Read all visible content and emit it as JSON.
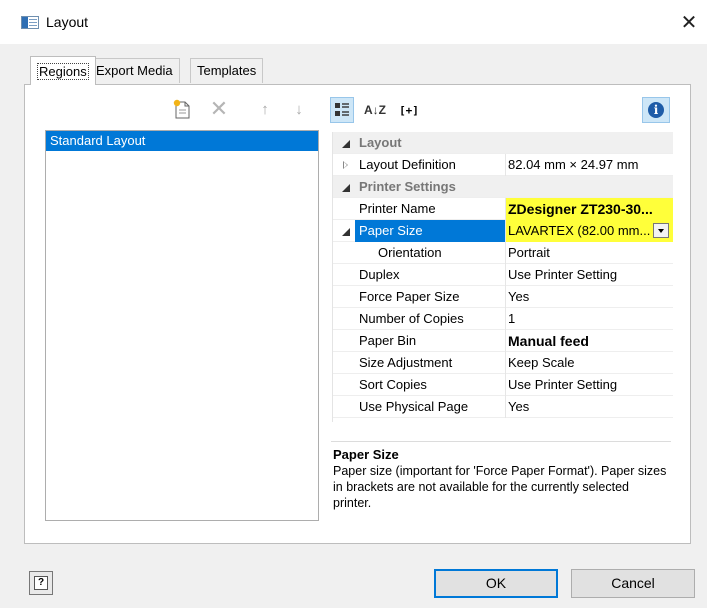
{
  "window": {
    "title": "Layout",
    "close_glyph": "✕"
  },
  "tabs": [
    {
      "label": "Regions",
      "active": true
    },
    {
      "label": "Export Media",
      "active": false
    },
    {
      "label": "Templates",
      "active": false
    }
  ],
  "regions": {
    "toolbar": [
      {
        "name": "new-region-icon"
      },
      {
        "name": "delete-icon",
        "glyph": "✕"
      },
      {
        "name": "move-up-icon",
        "glyph": "↑"
      },
      {
        "name": "move-down-icon",
        "glyph": "↓"
      }
    ],
    "items": [
      "Standard Layout"
    ]
  },
  "property_toolbar": {
    "sort_glyph": "A↓Z",
    "expand_label": "[+]",
    "info_glyph": "i"
  },
  "properties": {
    "layout_category": "Layout",
    "layout_definition": {
      "name": "Layout Definition",
      "value": "82.04 mm × 24.97 mm"
    },
    "printer_category": "Printer Settings",
    "rows": [
      {
        "name": "Printer Name",
        "value": "ZDesigner ZT230-30..."
      },
      {
        "name": "Paper Size",
        "value": "LAVARTEX (82.00 mm..."
      },
      {
        "name": "Orientation",
        "value": "Portrait"
      },
      {
        "name": "Duplex",
        "value": "Use Printer Setting"
      },
      {
        "name": "Force Paper Size",
        "value": "Yes"
      },
      {
        "name": "Number of Copies",
        "value": "1"
      },
      {
        "name": "Paper Bin",
        "value": "Manual feed"
      },
      {
        "name": "Size Adjustment",
        "value": "Keep Scale"
      },
      {
        "name": "Sort Copies",
        "value": "Use Printer Setting"
      },
      {
        "name": "Use Physical Page",
        "value": "Yes"
      }
    ]
  },
  "description": {
    "title": "Paper Size",
    "text": "Paper size (important for 'Force Paper Format'). Paper sizes in brackets are not available for the currently selected printer."
  },
  "footer": {
    "help_glyph": "?",
    "ok_label": "OK",
    "cancel_label": "Cancel"
  },
  "colors": {
    "selection": "#0078d7",
    "highlight": "#ffff3a",
    "info": "#1e5ca8"
  }
}
